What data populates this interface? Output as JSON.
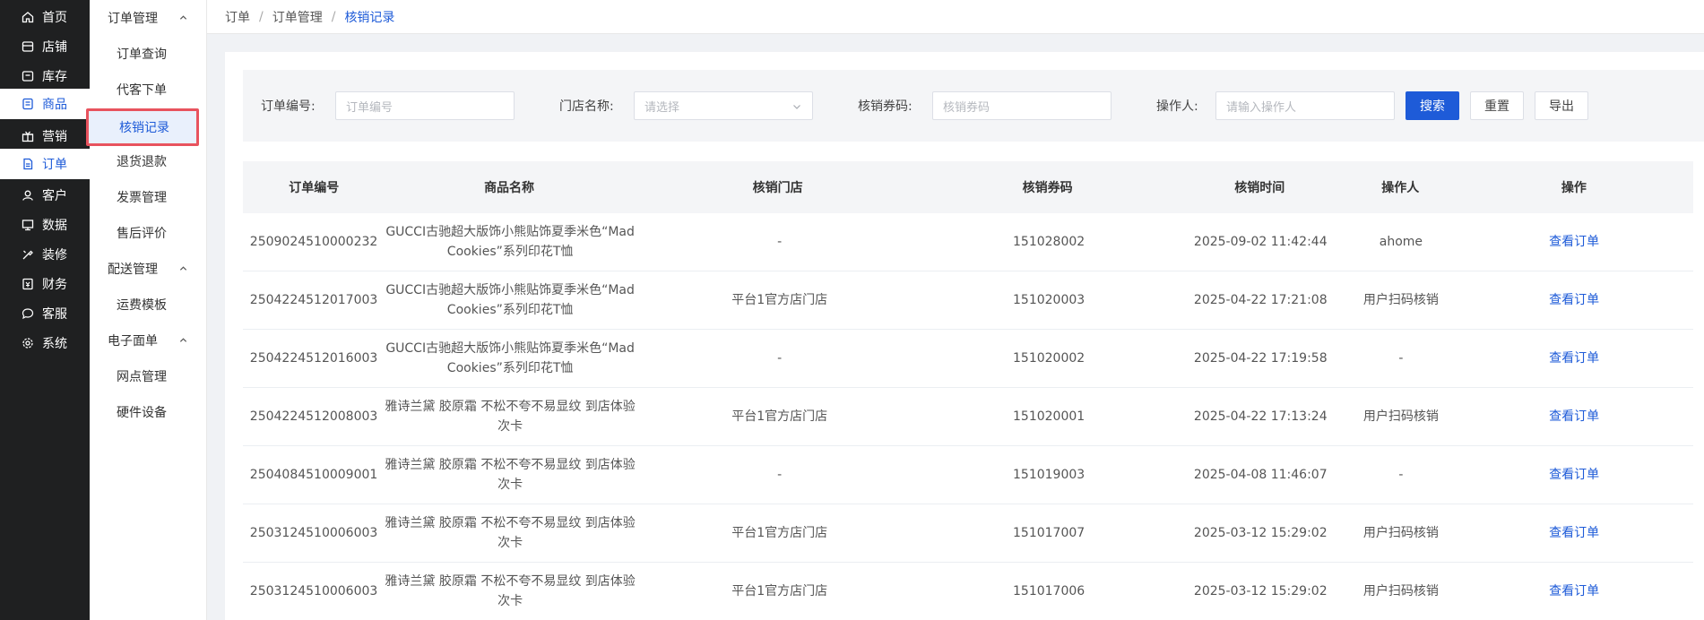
{
  "nav1": [
    {
      "label": "首页",
      "icon": "home-icon"
    },
    {
      "label": "店铺",
      "icon": "store-icon"
    },
    {
      "label": "库存",
      "icon": "inventory-icon"
    },
    {
      "label": "商品",
      "icon": "product-icon"
    },
    {
      "label": "营销",
      "icon": "gift-icon"
    },
    {
      "label": "订单",
      "icon": "order-icon"
    },
    {
      "label": "客户",
      "icon": "customer-icon"
    },
    {
      "label": "数据",
      "icon": "data-icon"
    },
    {
      "label": "装修",
      "icon": "decorate-icon"
    },
    {
      "label": "财务",
      "icon": "finance-icon"
    },
    {
      "label": "客服",
      "icon": "service-icon"
    },
    {
      "label": "系统",
      "icon": "settings-icon"
    }
  ],
  "nav2": {
    "order_group": "订单管理",
    "order_items": [
      "订单查询",
      "代客下单",
      "核销记录",
      "退货退款",
      "发票管理",
      "售后评价"
    ],
    "delivery_group": "配送管理",
    "delivery_items": [
      "运费模板"
    ],
    "waybill_group": "电子面单",
    "waybill_items": [
      "网点管理",
      "硬件设备"
    ]
  },
  "breadcrumb": [
    "订单",
    "订单管理",
    "核销记录"
  ],
  "filter": {
    "order_no_label": "订单编号:",
    "order_no_placeholder": "订单编号",
    "store_label": "门店名称:",
    "store_placeholder": "请选择",
    "coupon_label": "核销券码:",
    "coupon_placeholder": "核销券码",
    "operator_label": "操作人:",
    "operator_placeholder": "请输入操作人",
    "search_label": "搜索",
    "reset_label": "重置",
    "export_label": "导出"
  },
  "table": {
    "headers": [
      "订单编号",
      "商品名称",
      "核销门店",
      "核销券码",
      "核销时间",
      "操作人",
      "操作"
    ],
    "rows": [
      {
        "order_no": "2509024510000232",
        "product": "GUCCI古驰超大版饰小熊贴饰夏季米色“Mad Cookies”系列印花T恤",
        "store": "-",
        "coupon": "151028002",
        "time": "2025-09-02 11:42:44",
        "operator": "ahome",
        "action": "查看订单"
      },
      {
        "order_no": "2504224512017003",
        "product": "GUCCI古驰超大版饰小熊贴饰夏季米色“Mad Cookies”系列印花T恤",
        "store": "平台1官方店门店",
        "coupon": "151020003",
        "time": "2025-04-22 17:21:08",
        "operator": "用户扫码核销",
        "action": "查看订单"
      },
      {
        "order_no": "2504224512016003",
        "product": "GUCCI古驰超大版饰小熊贴饰夏季米色“Mad Cookies”系列印花T恤",
        "store": "-",
        "coupon": "151020002",
        "time": "2025-04-22 17:19:58",
        "operator": "-",
        "action": "查看订单"
      },
      {
        "order_no": "2504224512008003",
        "product": "雅诗兰黛 胶原霜 不松不夸不易显纹 到店体验次卡",
        "store": "平台1官方店门店",
        "coupon": "151020001",
        "time": "2025-04-22 17:13:24",
        "operator": "用户扫码核销",
        "action": "查看订单"
      },
      {
        "order_no": "2504084510009001",
        "product": "雅诗兰黛 胶原霜 不松不夸不易显纹 到店体验次卡",
        "store": "-",
        "coupon": "151019003",
        "time": "2025-04-08 11:46:07",
        "operator": "-",
        "action": "查看订单"
      },
      {
        "order_no": "2503124510006003",
        "product": "雅诗兰黛 胶原霜 不松不夸不易显纹 到店体验次卡",
        "store": "平台1官方店门店",
        "coupon": "151017007",
        "time": "2025-03-12 15:29:02",
        "operator": "用户扫码核销",
        "action": "查看订单"
      },
      {
        "order_no": "2503124510006003",
        "product": "雅诗兰黛 胶原霜 不松不夸不易显纹 到店体验次卡",
        "store": "平台1官方店门店",
        "coupon": "151017006",
        "time": "2025-03-12 15:29:02",
        "operator": "用户扫码核销",
        "action": "查看订单"
      }
    ]
  },
  "colors": {
    "accent": "#1e5bd8",
    "nav_bg": "#1f2021",
    "highlight_border": "#e8535e"
  }
}
